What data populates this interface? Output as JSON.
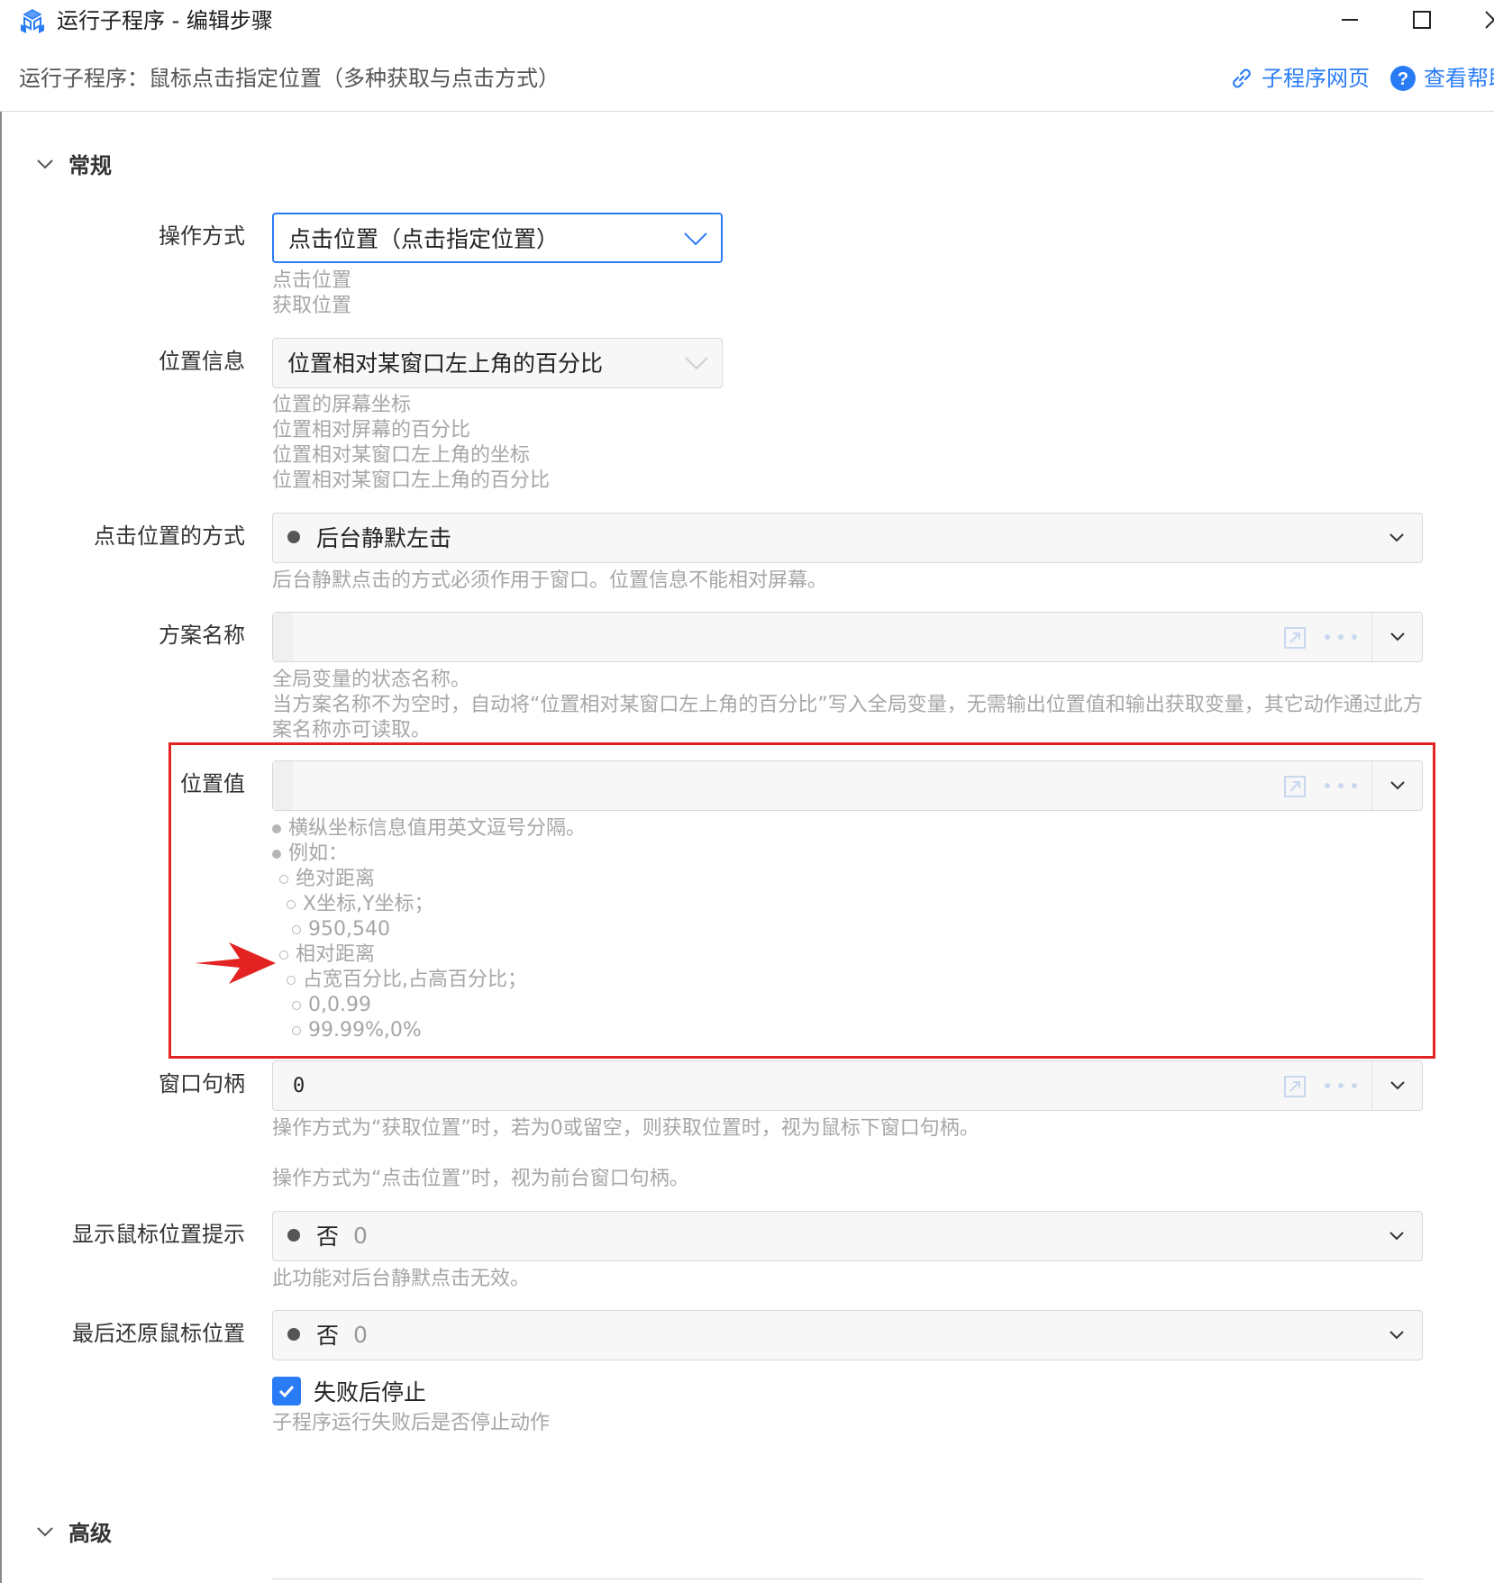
{
  "window": {
    "title": "运行子程序 - 编辑步骤",
    "minimize_icon": "minimize-icon",
    "maximize_icon": "maximize-icon",
    "close_icon": "close-icon"
  },
  "header": {
    "step_title": "运行子程序：鼠标点击指定位置（多种获取与点击方式）",
    "link_subpage": "子程序网页",
    "link_help": "查看帮助"
  },
  "sections": {
    "general": "常规",
    "advanced": "高级"
  },
  "form": {
    "operation": {
      "label": "操作方式",
      "value": "点击位置（点击指定位置）",
      "options": [
        "点击位置",
        "获取位置"
      ]
    },
    "position_info": {
      "label": "位置信息",
      "value": "位置相对某窗口左上角的百分比",
      "options": [
        "位置的屏幕坐标",
        "位置相对屏幕的百分比",
        "位置相对某窗口左上角的坐标",
        "位置相对某窗口左上角的百分比"
      ]
    },
    "click_method": {
      "label": "点击位置的方式",
      "value": "后台静默左击",
      "hint": "后台静默点击的方式必须作用于窗口。位置信息不能相对屏幕。"
    },
    "scheme_name": {
      "label": "方案名称",
      "value": "",
      "hint1": "全局变量的状态名称。",
      "hint2": "当方案名称不为空时，自动将“位置相对某窗口左上角的百分比”写入全局变量，无需输出位置值和输出获取变量，其它动作通过此方案名称亦可读取。"
    },
    "position_value": {
      "label": "位置值",
      "value": "",
      "hints": [
        "横纵坐标信息值用英文逗号分隔。",
        "例如：",
        "绝对距离",
        "X坐标,Y坐标；",
        "950,540",
        "相对距离",
        "占宽百分比,占高百分比；",
        "0,0.99",
        "99.99%,0%"
      ]
    },
    "window_handle": {
      "label": "窗口句柄",
      "value": "0",
      "hint1": "操作方式为“获取位置”时，若为0或留空，则获取位置时，视为鼠标下窗口句柄。",
      "hint2": "操作方式为“点击位置”时，视为前台窗口句柄。"
    },
    "show_mouse_hint": {
      "label": "显示鼠标位置提示",
      "value": "否",
      "sub_value": "0",
      "hint": "此功能对后台静默点击无效。"
    },
    "restore_mouse": {
      "label": "最后还原鼠标位置",
      "value": "否",
      "sub_value": "0"
    },
    "stop_on_fail": {
      "label": "失败后停止",
      "checked": true,
      "hint": "子程序运行失败后是否停止动作"
    }
  },
  "colors": {
    "accent": "#2a7cf6",
    "highlight": "#e32222"
  }
}
